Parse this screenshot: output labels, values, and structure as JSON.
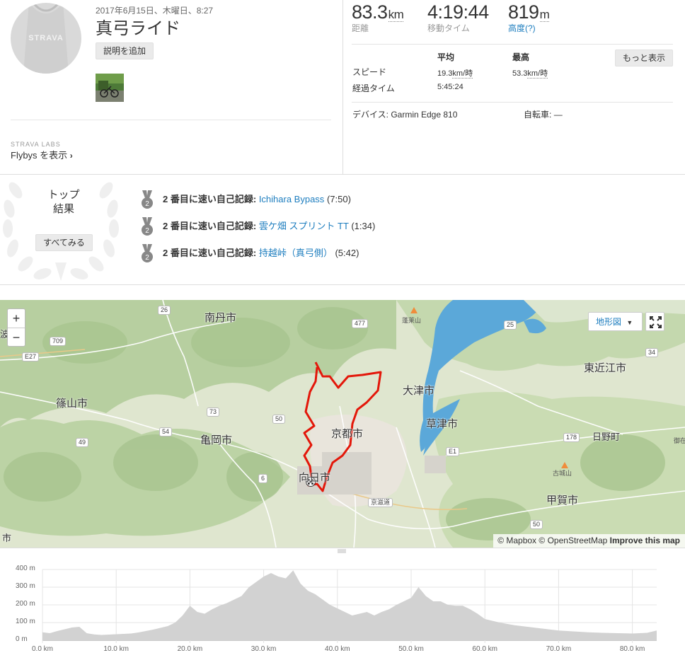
{
  "activity": {
    "date": "2017年6月15日、木曜日、8:27",
    "title": "真弓ライド",
    "add_description_label": "説明を追加",
    "avatar_brand": "STRAVA",
    "strava_labs_label": "STRAVA LABS",
    "flybys_label": "Flybys を表示"
  },
  "stats": {
    "distance_value": "83.3",
    "distance_unit": "km",
    "distance_label": "距離",
    "moving_time_value": "4:19:44",
    "moving_time_label": "移動タイム",
    "elevation_value": "819",
    "elevation_unit": "m",
    "elevation_label": "高度(?)",
    "col_avg": "平均",
    "col_max": "最高",
    "row_speed": "スピード",
    "speed_avg": "19.3",
    "speed_max": "53.3",
    "speed_unit": "km/時",
    "row_elapsed": "経過タイム",
    "elapsed_avg": "5:45:24",
    "more_label": "もっと表示",
    "device_label": "デバイス:",
    "device_value": "Garmin Edge 810",
    "bike_label": "自転車:",
    "bike_value": "—"
  },
  "achievements": {
    "top_label_1": "トップ",
    "top_label_2": "結果",
    "see_all_label": "すべてみる",
    "items": [
      {
        "rank": "2",
        "prefix": "2 番目に速い自己記録",
        "segment": "Ichihara Bypass",
        "time": "(7:50)"
      },
      {
        "rank": "2",
        "prefix": "2 番目に速い自己記録",
        "segment": "雲ケ畑 スプリント TT",
        "time": "(1:34)"
      },
      {
        "rank": "2",
        "prefix": "2 番目に速い自己記録",
        "segment": "持越峠（真弓側）",
        "time": "(5:42)"
      }
    ]
  },
  "map": {
    "zoom_in": "+",
    "zoom_out": "−",
    "map_type_label": "地形図",
    "attribution_mapbox": "© Mapbox",
    "attribution_osm": "© OpenStreetMap",
    "improve_label": "Improve this map",
    "cities": {
      "nantan": "南丹市",
      "sasayama": "篠山市",
      "kameoka": "亀岡市",
      "kyoto": "京都市",
      "muko": "向日市",
      "otsu": "大津市",
      "kusatsu": "草津市",
      "higashiomi": "東近江市",
      "hino": "日野町",
      "koka": "甲賀市",
      "edge_left_top": "波",
      "edge_left_bottom": "市"
    },
    "mountains": {
      "horai": "蓬莱山",
      "kojo": "古城山",
      "fukenakai": "御在"
    },
    "roads": [
      "26",
      "477",
      "25",
      "709",
      "E27",
      "73",
      "54",
      "49",
      "50",
      "6",
      "178",
      "E1",
      "34",
      "50",
      "京滋道"
    ]
  },
  "elevation": {
    "y_labels": [
      "400 m",
      "300 m",
      "200 m",
      "100 m",
      "0 m"
    ],
    "x_labels": [
      "0.0 km",
      "10.0 km",
      "20.0 km",
      "30.0 km",
      "40.0 km",
      "50.0 km",
      "60.0 km",
      "70.0 km",
      "80.0 km"
    ]
  },
  "chart_data": {
    "type": "area",
    "xlabel": "",
    "ylabel": "",
    "xlim": [
      0,
      83.3
    ],
    "ylim": [
      0,
      400
    ],
    "x": [
      0,
      1,
      2,
      3,
      4,
      5,
      6,
      7,
      8,
      9,
      10,
      11,
      12,
      13,
      14,
      15,
      16,
      17,
      18,
      19,
      20,
      21,
      22,
      23,
      24,
      25,
      26,
      27,
      28,
      29,
      30,
      31,
      32,
      33,
      34,
      35,
      36,
      37,
      38,
      39,
      40,
      41,
      42,
      43,
      44,
      45,
      46,
      47,
      48,
      49,
      50,
      51,
      52,
      53,
      54,
      55,
      56,
      57,
      58,
      59,
      60,
      62,
      64,
      66,
      68,
      70,
      72,
      74,
      76,
      78,
      80,
      82,
      83.3
    ],
    "series": [
      {
        "values": [
          45,
          40,
          52,
          62,
          72,
          76,
          40,
          33,
          30,
          32,
          34,
          36,
          38,
          44,
          52,
          60,
          70,
          80,
          100,
          140,
          195,
          160,
          150,
          175,
          195,
          210,
          230,
          250,
          300,
          330,
          360,
          380,
          360,
          350,
          395,
          320,
          280,
          260,
          230,
          200,
          180,
          160,
          140,
          150,
          160,
          140,
          160,
          175,
          200,
          220,
          240,
          300,
          250,
          220,
          220,
          200,
          195,
          195,
          175,
          150,
          120,
          100,
          85,
          75,
          65,
          55,
          50,
          45,
          42,
          40,
          38,
          42,
          55
        ]
      }
    ]
  }
}
